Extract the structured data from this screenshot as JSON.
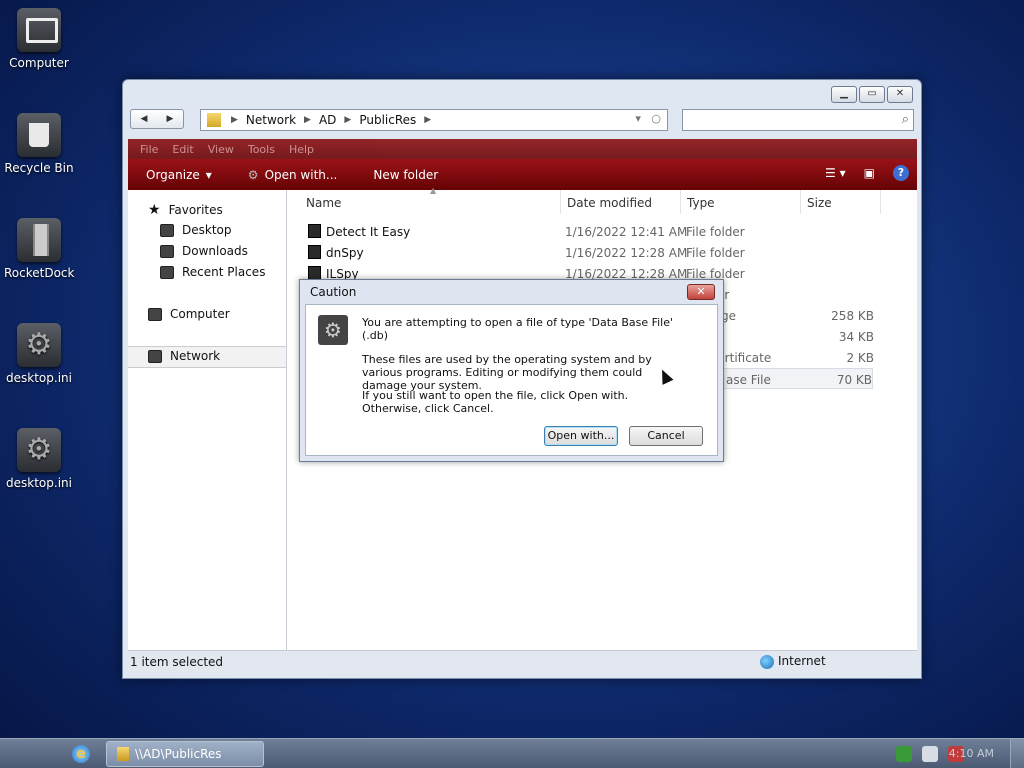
{
  "desktop": {
    "icons": [
      {
        "label": "Computer"
      },
      {
        "label": "Recycle Bin"
      },
      {
        "label": "RocketDock"
      },
      {
        "label": "desktop.ini"
      },
      {
        "label": "desktop.ini"
      }
    ]
  },
  "explorer": {
    "address": {
      "crumbs": [
        "Network",
        "AD",
        "PublicRes"
      ]
    },
    "menu": [
      "File",
      "Edit",
      "View",
      "Tools",
      "Help"
    ],
    "toolbar": {
      "organize": "Organize",
      "open_with": "Open with...",
      "new_folder": "New folder"
    },
    "nav": {
      "favorites": "Favorites",
      "desktop": "Desktop",
      "downloads": "Downloads",
      "recent": "Recent Places",
      "computer": "Computer",
      "network": "Network"
    },
    "columns": {
      "name": "Name",
      "date": "Date modified",
      "type": "Type",
      "size": "Size"
    },
    "rows": [
      {
        "name": "Detect It Easy",
        "date": "1/16/2022 12:41 AM",
        "type": "File folder",
        "size": ""
      },
      {
        "name": "dnSpy",
        "date": "1/16/2022 12:28 AM",
        "type": "File folder",
        "size": ""
      },
      {
        "name": "ILSpy",
        "date": "1/16/2022 12:28 AM",
        "type": "File folder",
        "size": ""
      },
      {
        "name": "",
        "date": "",
        "type": "lder",
        "size": ""
      },
      {
        "name": "",
        "date": "",
        "type": "nage",
        "size": "258 KB"
      },
      {
        "name": "",
        "date": "",
        "type": "",
        "size": "34 KB"
      },
      {
        "name": "",
        "date": "",
        "type": "y Certificate",
        "size": "2 KB"
      },
      {
        "name": "",
        "date": "",
        "type": "ase File",
        "size": "70 KB"
      }
    ],
    "status": {
      "selection": "1 item selected",
      "zone": "Internet"
    }
  },
  "dialog": {
    "title": "Caution",
    "line1": "You are attempting to open a file of type 'Data Base File' (.db)",
    "line2": "These files are used by the operating system and by various programs. Editing or modifying them could damage your system.",
    "line3": "If you still want to open the file, click Open with. Otherwise, click Cancel.",
    "open_with": "Open with...",
    "cancel": "Cancel"
  },
  "taskbar": {
    "window_label": "\\\\AD\\PublicRes",
    "clock": "4:10 AM"
  }
}
